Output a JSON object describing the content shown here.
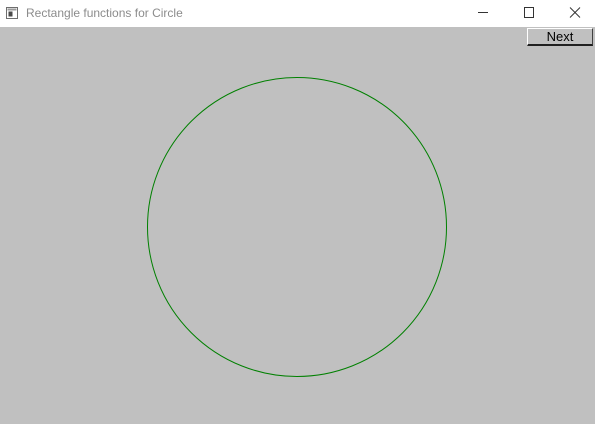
{
  "window": {
    "title": "Rectangle functions for Circle",
    "icon": "app-window-icon",
    "controls": {
      "minimize_icon": "minimize-icon",
      "maximize_icon": "maximize-icon",
      "close_icon": "close-icon"
    }
  },
  "toolbar": {
    "next_label": "Next"
  },
  "canvas": {
    "background": "#c0c0c0",
    "shape": "circle",
    "stroke_color": "#008000"
  }
}
